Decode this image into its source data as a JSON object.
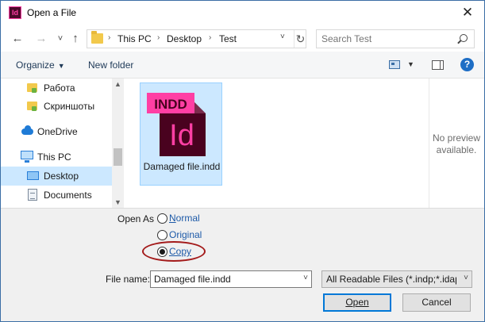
{
  "window": {
    "title": "Open a File",
    "app_icon_text": "Id",
    "close_glyph": "✕"
  },
  "nav": {
    "back": "←",
    "forward": "→",
    "recent": "˅",
    "up": "↑",
    "breadcrumbs": [
      "This PC",
      "Desktop",
      "Test"
    ],
    "separator": "›",
    "dropdown": "˅",
    "refresh": "↻"
  },
  "search": {
    "placeholder": "Search Test"
  },
  "toolbar": {
    "organize": "Organize",
    "new_folder": "New folder",
    "help": "?"
  },
  "sidebar": {
    "items": [
      {
        "label": "Работа",
        "icon": "folder-pinned-icon"
      },
      {
        "label": "Скриншоты",
        "icon": "folder-pinned-icon"
      },
      {
        "label": "OneDrive",
        "icon": "onedrive-icon"
      },
      {
        "label": "This PC",
        "icon": "this-pc-icon"
      },
      {
        "label": "Desktop",
        "icon": "desktop-icon",
        "selected": true
      },
      {
        "label": "Documents",
        "icon": "documents-icon"
      }
    ]
  },
  "files": [
    {
      "name": "Damaged file.indd",
      "badge": "INDD",
      "icon_text": "Id",
      "selected": true
    }
  ],
  "preview": {
    "text": "No preview available."
  },
  "open_as": {
    "label": "Open As",
    "options": [
      {
        "label": "Normal",
        "checked": false
      },
      {
        "label": "Original",
        "checked": false
      },
      {
        "label": "Copy",
        "checked": true
      }
    ]
  },
  "filename": {
    "label": "File name:",
    "value": "Damaged file.indd"
  },
  "filter": {
    "value": "All Readable Files (*.indp;*.idap"
  },
  "buttons": {
    "open": "Open",
    "cancel": "Cancel"
  },
  "colors": {
    "accent": "#0078d7",
    "selection": "#cce8ff",
    "indesign_dark": "#49021f",
    "indesign_pink": "#ff3fa4",
    "highlight_ring": "#a31a1a"
  }
}
